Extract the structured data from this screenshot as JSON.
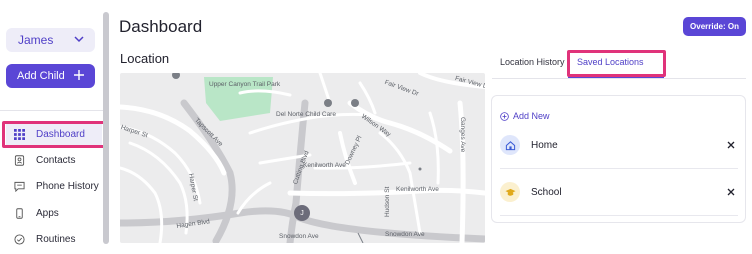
{
  "sidebar": {
    "user_select": {
      "value": "James",
      "icon": "chevron-down-icon"
    },
    "add_child_label": "Add Child",
    "nav": [
      {
        "label": "Dashboard",
        "icon": "grid-icon",
        "active": true
      },
      {
        "label": "Contacts",
        "icon": "contacts-icon",
        "active": false
      },
      {
        "label": "Phone History",
        "icon": "chat-icon",
        "active": false
      },
      {
        "label": "Apps",
        "icon": "phone-icon",
        "active": false
      },
      {
        "label": "Routines",
        "icon": "check-circle-icon",
        "active": false
      }
    ]
  },
  "header": {
    "title": "Dashboard",
    "override_label": "Override: On"
  },
  "location": {
    "section_title": "Location",
    "map": {
      "labels": [
        "Upper Canyon Trail Park",
        "Tapscott Ave",
        "Del Norte Child Care",
        "Harper St",
        "Wilson Way",
        "Fair View Dr",
        "Fair View Dr",
        "Ganges Ave",
        "Cutting Blvd",
        "Downey Pl",
        "Kenilworth Ave",
        "Kenilworth Ave",
        "Harper St",
        "Hudson St",
        "Hagen Blvd",
        "Snowdon Ave",
        "Snowdon Ave"
      ],
      "marker_initial": "J"
    }
  },
  "tabs": {
    "history_label": "Location History",
    "saved_label": "Saved Locations",
    "active": "saved"
  },
  "saved_locations": {
    "add_new_label": "Add New",
    "items": [
      {
        "name": "Home",
        "icon": "home-icon",
        "color": "#dfe6fb"
      },
      {
        "name": "School",
        "icon": "graduation-cap-icon",
        "color": "#fbf0cf"
      }
    ]
  },
  "colors": {
    "accent": "#5a46d6",
    "highlight": "#e0337a"
  }
}
